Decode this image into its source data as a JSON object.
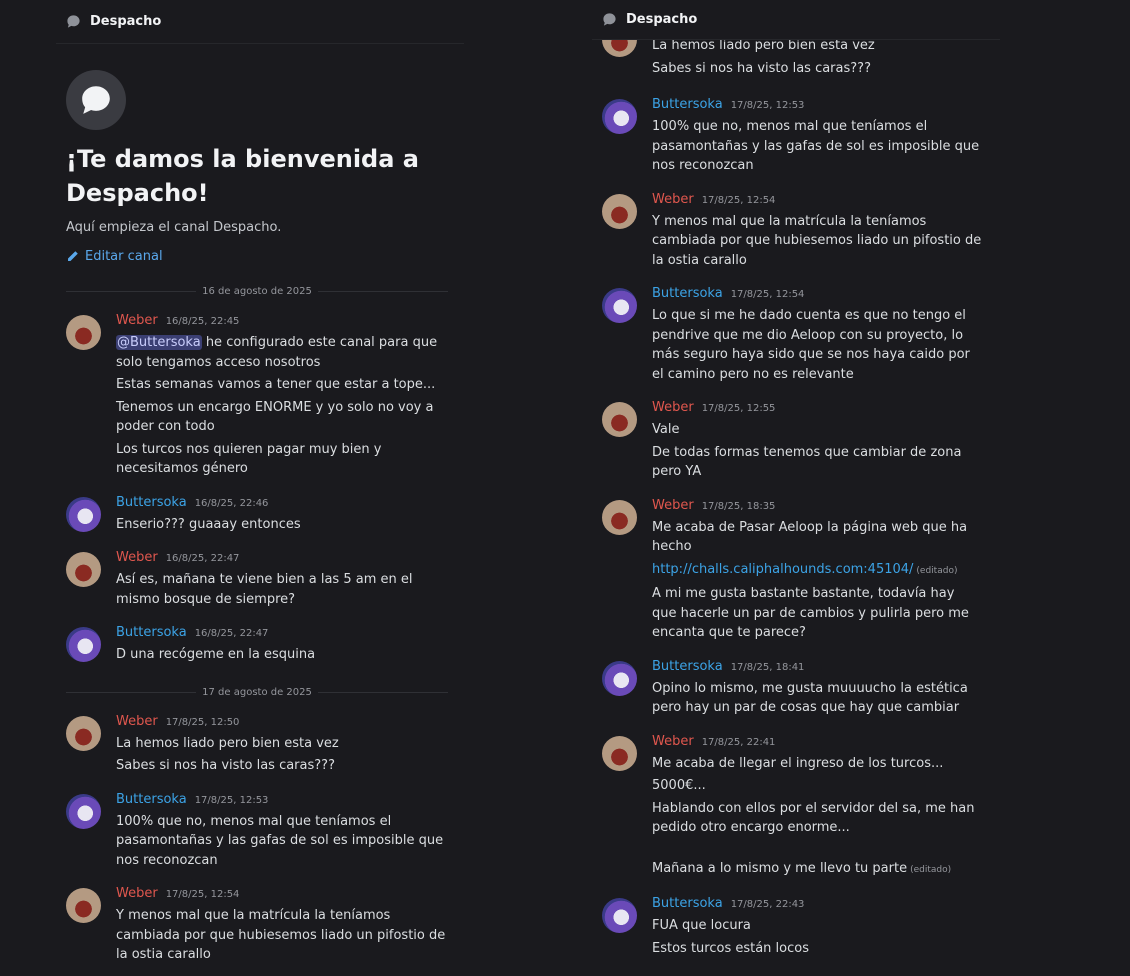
{
  "channel": {
    "name": "Despacho"
  },
  "welcome": {
    "title": "¡Te damos la bienvenida a Despacho!",
    "subtitle": "Aquí empieza el canal Despacho.",
    "edit_label": "Editar canal"
  },
  "dates": {
    "day1": "16 de agosto de 2025",
    "day2": "17 de agosto de 2025"
  },
  "left": {
    "m1": {
      "author": "Weber",
      "ts": "16/8/25, 22:45",
      "mention": "@Buttersoka",
      "l1": " he configurado este canal para que solo tengamos acceso nosotros",
      "l2": "Estas semanas vamos a tener que estar a tope...",
      "l3": "Tenemos un encargo ENORME y yo solo no voy a poder con todo",
      "l4": "Los turcos nos quieren pagar muy bien y necesitamos género"
    },
    "m2": {
      "author": "Buttersoka",
      "ts": "16/8/25, 22:46",
      "l1": "Enserio??? guaaay entonces"
    },
    "m3": {
      "author": "Weber",
      "ts": "16/8/25, 22:47",
      "l1": "Así es, mañana te viene bien a las 5 am en el mismo bosque de siempre?"
    },
    "m4": {
      "author": "Buttersoka",
      "ts": "16/8/25, 22:47",
      "l1": "D una recógeme en la esquina"
    },
    "m5": {
      "author": "Weber",
      "ts": "17/8/25, 12:50",
      "l1": "La hemos liado pero bien esta vez",
      "l2": "Sabes si nos ha visto las caras???"
    },
    "m6": {
      "author": "Buttersoka",
      "ts": "17/8/25, 12:53",
      "l1": "100% que no, menos mal que teníamos el pasamontañas y las gafas de sol es imposible que nos reconozcan"
    },
    "m7": {
      "author": "Weber",
      "ts": "17/8/25, 12:54",
      "l1": "Y menos mal que la matrícula la teníamos cambiada por que hubiesemos liado un pifostio de la ostia carallo"
    }
  },
  "right": {
    "top": {
      "l1": "La hemos liado pero bien esta vez",
      "l2": "Sabes si nos ha visto las caras???"
    },
    "m1": {
      "author": "Buttersoka",
      "ts": "17/8/25, 12:53",
      "l1": "100% que no, menos mal que teníamos el pasamontañas y las gafas de sol es imposible que nos reconozcan"
    },
    "m2": {
      "author": "Weber",
      "ts": "17/8/25, 12:54",
      "l1": "Y menos mal que la matrícula la teníamos cambiada por que hubiesemos liado un pifostio de la ostia carallo"
    },
    "m3": {
      "author": "Buttersoka",
      "ts": "17/8/25, 12:54",
      "l1": "Lo que si me he dado cuenta es que no tengo el pendrive que me dio Aeloop con su proyecto, lo más seguro haya sido que se nos haya caido por el camino pero no es relevante"
    },
    "m4": {
      "author": "Weber",
      "ts": "17/8/25, 12:55",
      "l1": "Vale",
      "l2": "De todas formas tenemos que cambiar de zona pero YA"
    },
    "m5": {
      "author": "Weber",
      "ts": "17/8/25, 18:35",
      "l1": "Me acaba de Pasar Aeloop la página web que ha hecho",
      "link": "http://challs.caliphalhounds.com:45104/",
      "edited": "(editado)",
      "l3": "A mi me gusta bastante bastante, todavía hay que hacerle un par de cambios y pulirla pero me encanta que te parece?"
    },
    "m6": {
      "author": "Buttersoka",
      "ts": "17/8/25, 18:41",
      "l1": "Opino lo mismo, me gusta muuuucho la estética pero hay un par de cosas que hay que cambiar"
    },
    "m7": {
      "author": "Weber",
      "ts": "17/8/25, 22:41",
      "l1": "Me acaba de llegar el ingreso de los turcos...",
      "l2": "5000€...",
      "l3": "Hablando con ellos por el servidor del sa, me han pedido otro encargo enorme...",
      "l4": "Mañana a lo mismo y me llevo tu parte",
      "edited": "(editado)"
    },
    "m8": {
      "author": "Buttersoka",
      "ts": "17/8/25, 22:43",
      "l1": "FUA que locura",
      "l2": "Estos turcos están locos"
    }
  },
  "colors": {
    "weber": "#e0574e",
    "buttersoka": "#3ca3e6",
    "link": "#3ca3e6",
    "background": "#1a1a1e"
  }
}
